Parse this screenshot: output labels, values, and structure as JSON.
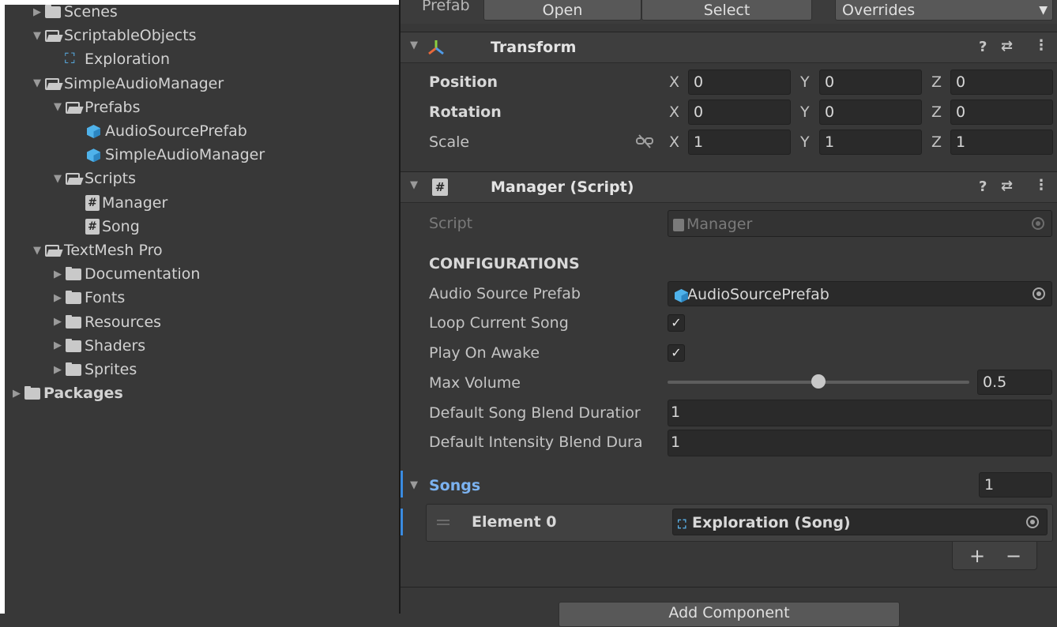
{
  "project": {
    "items": [
      {
        "label": "Scenes",
        "indent": 1,
        "icon": "folder-closed-icon",
        "arrow": "▶"
      },
      {
        "label": "ScriptableObjects",
        "indent": 1,
        "icon": "folder-open-icon",
        "arrow": "▼"
      },
      {
        "label": "Exploration",
        "indent": 2,
        "icon": "scriptable-object-icon",
        "arrow": ""
      },
      {
        "label": "SimpleAudioManager",
        "indent": 1,
        "icon": "folder-open-icon",
        "arrow": "▼"
      },
      {
        "label": "Prefabs",
        "indent": 2,
        "icon": "folder-open-icon",
        "arrow": "▼"
      },
      {
        "label": "AudioSourcePrefab",
        "indent": 3,
        "icon": "prefab-cube-icon",
        "arrow": ""
      },
      {
        "label": "SimpleAudioManager",
        "indent": 3,
        "icon": "prefab-cube-icon",
        "arrow": ""
      },
      {
        "label": "Scripts",
        "indent": 2,
        "icon": "folder-open-icon",
        "arrow": "▼"
      },
      {
        "label": "Manager",
        "indent": 3,
        "icon": "csharp-script-icon",
        "arrow": ""
      },
      {
        "label": "Song",
        "indent": 3,
        "icon": "csharp-script-icon",
        "arrow": ""
      },
      {
        "label": "TextMesh Pro",
        "indent": 1,
        "icon": "folder-open-icon",
        "arrow": "▼"
      },
      {
        "label": "Documentation",
        "indent": 2,
        "icon": "folder-closed-icon",
        "arrow": "▶"
      },
      {
        "label": "Fonts",
        "indent": 2,
        "icon": "folder-closed-icon",
        "arrow": "▶"
      },
      {
        "label": "Resources",
        "indent": 2,
        "icon": "folder-closed-icon",
        "arrow": "▶"
      },
      {
        "label": "Shaders",
        "indent": 2,
        "icon": "folder-closed-icon",
        "arrow": "▶"
      },
      {
        "label": "Sprites",
        "indent": 2,
        "icon": "folder-closed-icon",
        "arrow": "▶"
      },
      {
        "label": "Packages",
        "indent": 0,
        "icon": "folder-closed-icon",
        "arrow": "▶",
        "bold": true
      }
    ]
  },
  "prefab_bar": {
    "label": "Prefab",
    "open": "Open",
    "select": "Select",
    "overrides": "Overrides"
  },
  "transform": {
    "title": "Transform",
    "position": {
      "label": "Position",
      "x": "0",
      "y": "0",
      "z": "0"
    },
    "rotation": {
      "label": "Rotation",
      "x": "0",
      "y": "0",
      "z": "0"
    },
    "scale": {
      "label": "Scale",
      "x": "1",
      "y": "1",
      "z": "1"
    },
    "axes": {
      "x": "X",
      "y": "Y",
      "z": "Z"
    }
  },
  "manager": {
    "title": "Manager (Script)",
    "script_label": "Script",
    "script_value": "Manager",
    "section": "CONFIGURATIONS",
    "audio_source_label": "Audio Source Prefab",
    "audio_source_value": "AudioSourcePrefab",
    "loop_label": "Loop Current Song",
    "loop_checked": true,
    "play_label": "Play On Awake",
    "play_checked": true,
    "max_volume_label": "Max Volume",
    "max_volume_value": "0.5",
    "max_volume_fraction": 0.5,
    "song_blend_label": "Default Song Blend Duratior",
    "song_blend_value": "1",
    "intensity_blend_label": "Default Intensity Blend Dura",
    "intensity_blend_value": "1",
    "songs_label": "Songs",
    "songs_count": "1",
    "element_label": "Element 0",
    "element_value": "Exploration (Song)",
    "plus": "+",
    "minus": "−",
    "check_glyph": "✓"
  },
  "footer": {
    "add_component": "Add Component"
  },
  "colors": {
    "panel_bg": "#383838",
    "field_bg": "#2a2a2a",
    "accent_blue": "#4fb2ea",
    "songs_label": "#7bb2f0"
  }
}
